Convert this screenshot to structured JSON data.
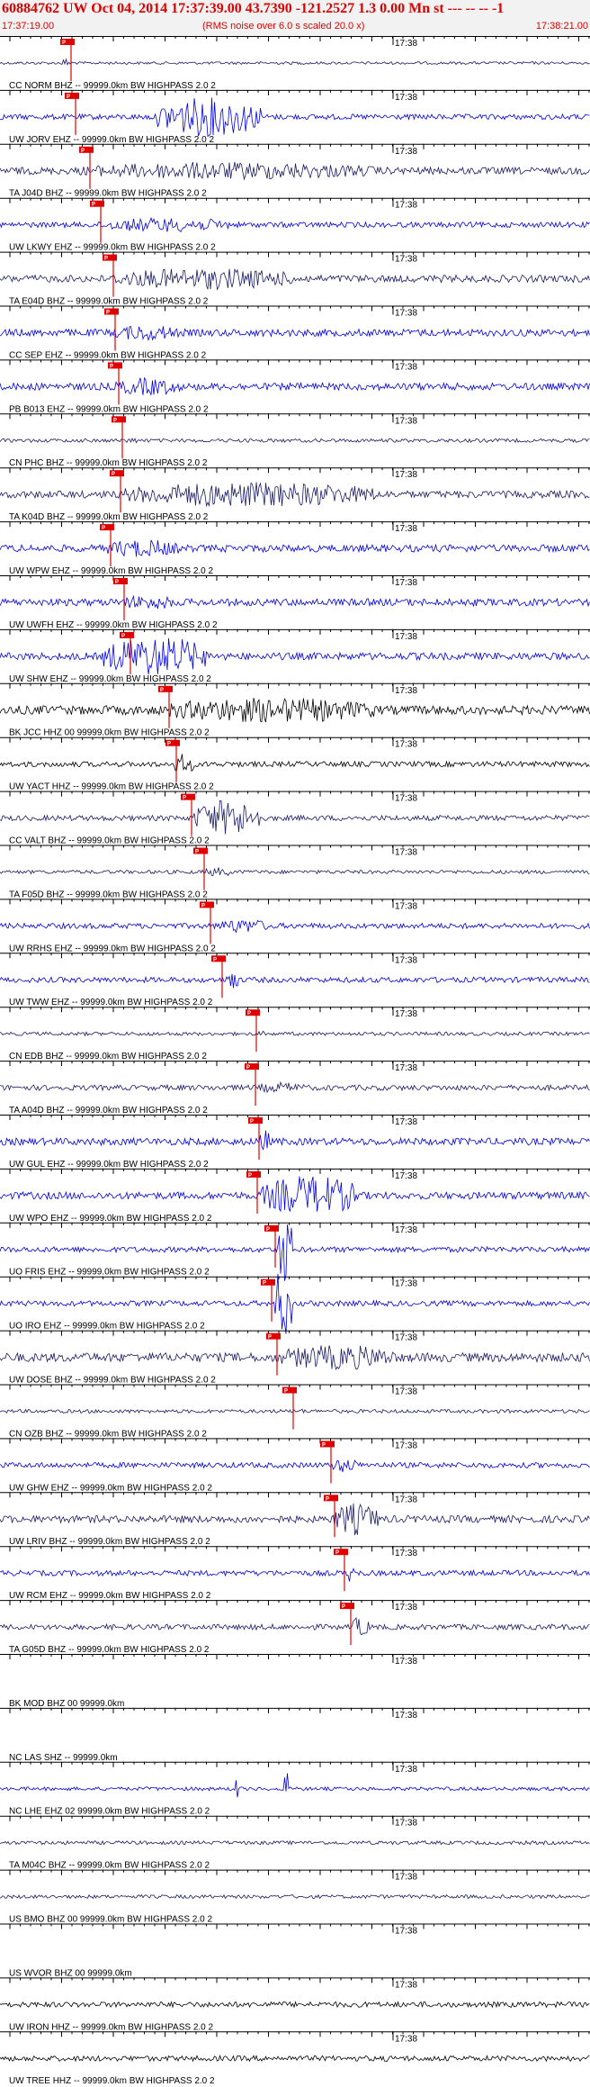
{
  "header": {
    "title": "60884762 UW Oct 04, 2014 17:37:39.00   43.7390 -121.2527  1.3 0.00 Mn st --- -- --  -1",
    "start_time": "17:37:19.00",
    "note": "(RMS noise over 6.0 s scaled 20.0 x)",
    "end_time": "17:38:21.00"
  },
  "chart_data": {
    "type": "seismogram",
    "minute_tick_label": "17:38",
    "colors": {
      "arrival": "#e00000",
      "blue": "#0000e0",
      "navy": "#1a1a66",
      "black": "#000000"
    },
    "traces": [
      {
        "label": "CC NORM BHZ -- 99999.0km BW HIGHPASS  2.0  2",
        "color": "navy",
        "amp": 1.5,
        "pick": 79,
        "burst": [
          68,
          78,
          5
        ]
      },
      {
        "label": "UW JORV EHZ -- 99999.0km BW HIGHPASS  2.0  2",
        "color": "blue",
        "amp": 3,
        "pick": 84,
        "burst": [
          175,
          290,
          22
        ]
      },
      {
        "label": "TA J04D BHZ -- 99999.0km BW HIGHPASS  2.0  2",
        "color": "navy",
        "amp": 4,
        "pick": 100,
        "burst": [
          90,
          420,
          10
        ]
      },
      {
        "label": "UW LKWY EHZ -- 99999.0km BW HIGHPASS  2.0  2",
        "color": "blue",
        "amp": 3,
        "pick": 112,
        "burst": [
          110,
          260,
          8
        ]
      },
      {
        "label": "TA E04D BHZ -- 99999.0km BW HIGHPASS  2.0  2",
        "color": "navy",
        "amp": 4,
        "pick": 126,
        "burst": [
          125,
          330,
          12
        ]
      },
      {
        "label": "CC SEP EHZ -- 99999.0km BW HIGHPASS  2.0  2",
        "color": "blue",
        "amp": 4,
        "pick": 128,
        "burst": [
          126,
          200,
          9
        ]
      },
      {
        "label": "PB B013 EHZ -- 99999.0km BW HIGHPASS  2.0  2",
        "color": "blue",
        "amp": 4,
        "pick": 132,
        "burst": [
          128,
          200,
          10
        ]
      },
      {
        "label": "CN PHC BHZ -- 99999.0km BW HIGHPASS  2.0  2",
        "color": "navy",
        "amp": 2,
        "pick": 136,
        "burst": [
          130,
          160,
          3
        ]
      },
      {
        "label": "TA K04D BHZ -- 99999.0km BW HIGHPASS  2.0  2",
        "color": "navy",
        "amp": 4,
        "pick": 134,
        "burst": [
          135,
          420,
          14
        ]
      },
      {
        "label": "UW WPW EHZ -- 99999.0km BW HIGHPASS  2.0  2",
        "color": "blue",
        "amp": 4,
        "pick": 123,
        "burst": [
          115,
          200,
          10
        ]
      },
      {
        "label": "UW UWFH EHZ -- 99999.0km BW HIGHPASS  2.0  2",
        "color": "blue",
        "amp": 4,
        "pick": 138,
        "burst": [
          130,
          200,
          8
        ]
      },
      {
        "label": "UW SHW EHZ -- 99999.0km BW HIGHPASS  2.0  2",
        "color": "blue",
        "amp": 4,
        "pick": 145,
        "burst": [
          115,
          230,
          22
        ]
      },
      {
        "label": "BK JCC HHZ 00 99999.0km BW HIGHPASS  2.0  2",
        "color": "black",
        "amp": 5,
        "pick": 188,
        "burst": [
          180,
          420,
          14
        ]
      },
      {
        "label": "UW YACT HHZ -- 99999.0km BW HIGHPASS  2.0  2",
        "color": "black",
        "amp": 3,
        "pick": 196,
        "burst": [
          193,
          215,
          12
        ]
      },
      {
        "label": "CC VALT BHZ -- 99999.0km BW HIGHPASS  2.0  2",
        "color": "navy",
        "amp": 3,
        "pick": 213,
        "burst": [
          215,
          290,
          20
        ]
      },
      {
        "label": "TA F05D BHZ -- 99999.0km BW HIGHPASS  2.0  2",
        "color": "navy",
        "amp": 2,
        "pick": 227,
        "burst": [
          225,
          260,
          5
        ]
      },
      {
        "label": "UW RRHS EHZ -- 99999.0km BW HIGHPASS  2.0  2",
        "color": "blue",
        "amp": 3,
        "pick": 234,
        "burst": [
          240,
          300,
          8
        ]
      },
      {
        "label": "UW TWW EHZ -- 99999.0km BW HIGHPASS  2.0  2",
        "color": "blue",
        "amp": 3,
        "pick": 247,
        "burst": [
          252,
          264,
          14
        ]
      },
      {
        "label": "CN EDB BHZ -- 99999.0km BW HIGHPASS  2.0  2",
        "color": "navy",
        "amp": 2,
        "pick": 285,
        "burst": [
          285,
          300,
          3
        ]
      },
      {
        "label": "TA A04D BHZ -- 99999.0km BW HIGHPASS  2.0  2",
        "color": "navy",
        "amp": 3,
        "pick": 284,
        "burst": [
          285,
          340,
          6
        ]
      },
      {
        "label": "UW GUL EHZ -- 99999.0km BW HIGHPASS  2.0  2",
        "color": "blue",
        "amp": 4,
        "pick": 288,
        "burst": [
          286,
          300,
          14
        ]
      },
      {
        "label": "UW WPO EHZ -- 99999.0km BW HIGHPASS  2.0  2",
        "color": "blue",
        "amp": 4,
        "pick": 286,
        "burst": [
          290,
          400,
          22
        ]
      },
      {
        "label": "UO FRIS EHZ -- 99999.0km BW HIGHPASS  2.0  2",
        "color": "blue",
        "amp": 3,
        "pick": 306,
        "burst": [
          308,
          325,
          40
        ]
      },
      {
        "label": "UO IRO EHZ -- 99999.0km BW HIGHPASS  2.0  2",
        "color": "blue",
        "amp": 3,
        "pick": 302,
        "burst": [
          305,
          325,
          40
        ]
      },
      {
        "label": "UW DOSE BHZ -- 99999.0km BW HIGHPASS  2.0  2",
        "color": "navy",
        "amp": 5,
        "pick": 308,
        "burst": [
          308,
          440,
          14
        ]
      },
      {
        "label": "CN OZB BHZ -- 99999.0km BW HIGHPASS  2.0  2",
        "color": "navy",
        "amp": 2,
        "pick": 326,
        "burst": [
          325,
          340,
          3
        ]
      },
      {
        "label": "UW GHW EHZ -- 99999.0km BW HIGHPASS  2.0  2",
        "color": "blue",
        "amp": 3,
        "pick": 368,
        "burst": [
          368,
          400,
          8
        ]
      },
      {
        "label": "UW LRIV BHZ -- 99999.0km BW HIGHPASS  2.0  2",
        "color": "navy",
        "amp": 4,
        "pick": 372,
        "burst": [
          370,
          420,
          18
        ]
      },
      {
        "label": "UW RCM EHZ -- 99999.0km BW HIGHPASS  2.0  2",
        "color": "blue",
        "amp": 3,
        "pick": 383,
        "burst": [
          385,
          395,
          10
        ]
      },
      {
        "label": "TA G05D BHZ -- 99999.0km BW HIGHPASS  2.0  2",
        "color": "navy",
        "amp": 3,
        "pick": 390,
        "burst": [
          392,
          410,
          12
        ]
      },
      {
        "label": "BK MOD BHZ 00 99999.0km",
        "color": "navy",
        "amp": 0,
        "pick": null,
        "burst": null
      },
      {
        "label": "NC LAS SHZ -- 99999.0km",
        "color": "navy",
        "amp": 0,
        "pick": null,
        "burst": null
      },
      {
        "label": "NC LHE EHZ 02 99999.0km BW HIGHPASS  2.0  2",
        "color": "blue",
        "amp": 2,
        "pick": null,
        "burst": null,
        "spikes": [
          263,
          318
        ]
      },
      {
        "label": "TA M04C BHZ -- 99999.0km BW HIGHPASS  2.0  2",
        "color": "navy",
        "amp": 2,
        "pick": null,
        "burst": null
      },
      {
        "label": "US BMO BHZ 00 99999.0km BW HIGHPASS  2.0  2",
        "color": "navy",
        "amp": 2,
        "pick": null,
        "burst": null
      },
      {
        "label": "US WVOR BHZ 00 99999.0km",
        "color": "navy",
        "amp": 0,
        "pick": null,
        "burst": null
      },
      {
        "label": "UW IRON HHZ -- 99999.0km BW HIGHPASS  2.0  2",
        "color": "black",
        "amp": 3,
        "pick": null,
        "burst": null
      },
      {
        "label": "UW TREE HHZ -- 99999.0km BW HIGHPASS  2.0  2",
        "color": "black",
        "amp": 3,
        "pick": null,
        "burst": null
      }
    ]
  }
}
